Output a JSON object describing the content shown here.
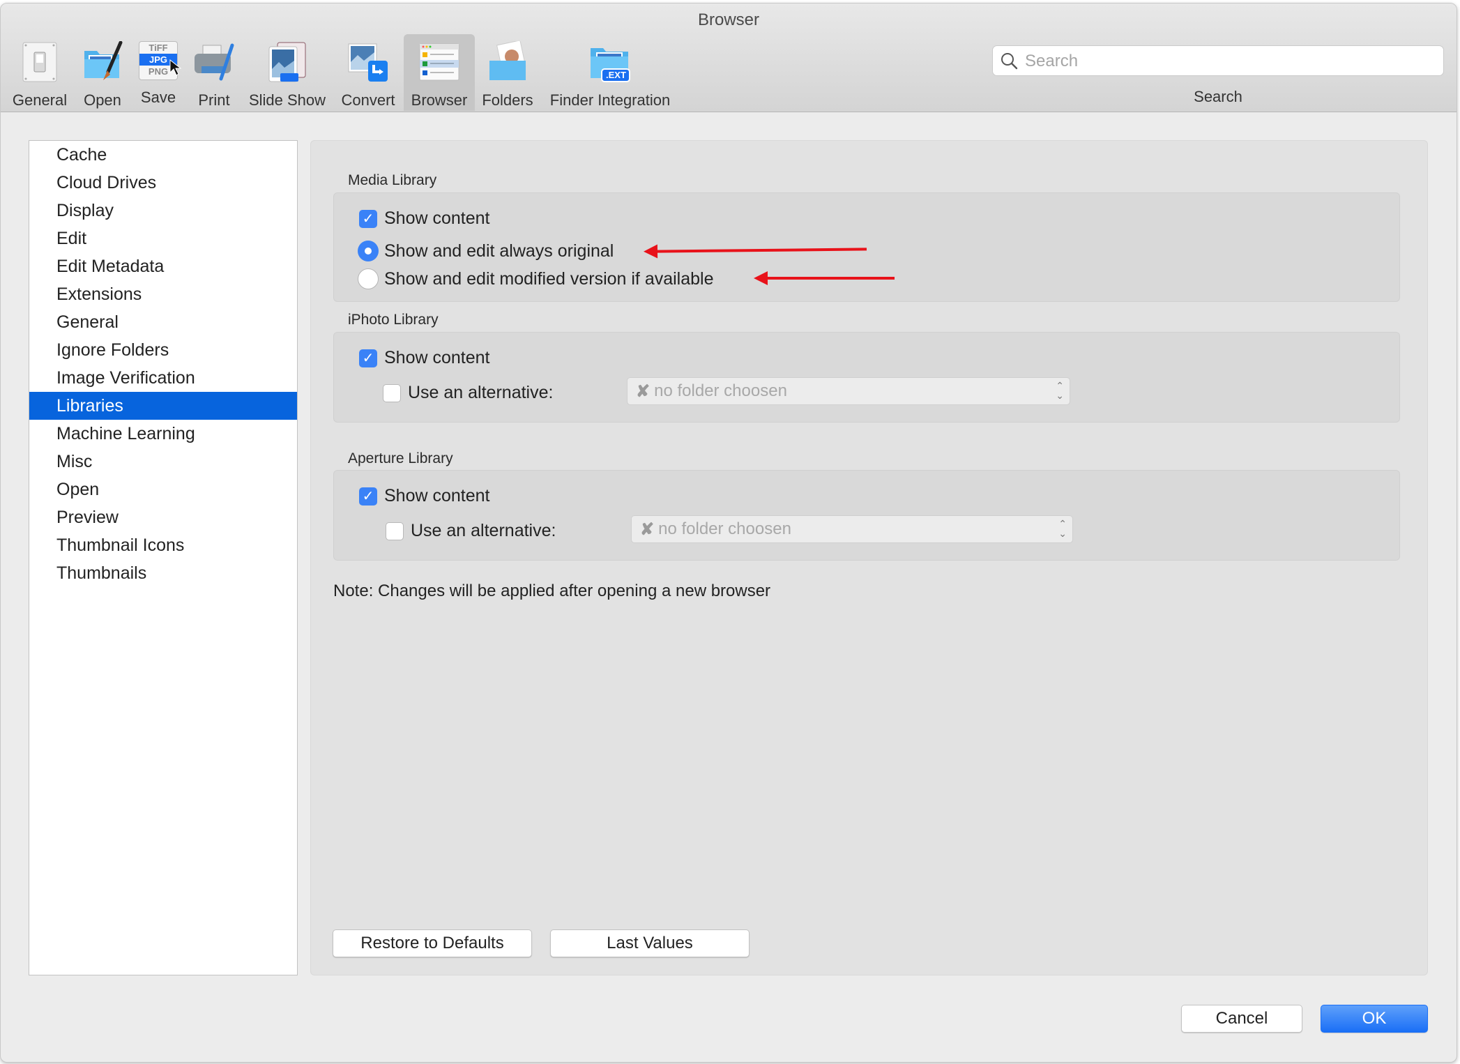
{
  "window": {
    "title": "Browser"
  },
  "toolbar": {
    "items": [
      {
        "label": "General",
        "icon": "light-switch-icon"
      },
      {
        "label": "Open",
        "icon": "folder-brush-icon"
      },
      {
        "label": "Save",
        "icon": "file-formats-icon"
      },
      {
        "label": "Print",
        "icon": "printer-icon"
      },
      {
        "label": "Slide Show",
        "icon": "slideshow-icon"
      },
      {
        "label": "Convert",
        "icon": "convert-icon"
      },
      {
        "label": "Browser",
        "icon": "browser-window-icon",
        "selected": true
      },
      {
        "label": "Folders",
        "icon": "folder-photo-icon"
      },
      {
        "label": "Finder Integration",
        "icon": "folder-ext-icon"
      }
    ],
    "save_icon_text": {
      "tiff": "TiFF",
      "jpg": "JPG",
      "png": "PNG"
    },
    "ext_badge": ".EXT",
    "search": {
      "placeholder": "Search",
      "value": "",
      "label": "Search"
    }
  },
  "sidebar": {
    "items": [
      {
        "label": "Cache"
      },
      {
        "label": "Cloud Drives"
      },
      {
        "label": "Display"
      },
      {
        "label": "Edit"
      },
      {
        "label": "Edit Metadata"
      },
      {
        "label": "Extensions"
      },
      {
        "label": "General"
      },
      {
        "label": "Ignore Folders"
      },
      {
        "label": "Image Verification"
      },
      {
        "label": "Libraries",
        "selected": true
      },
      {
        "label": "Machine Learning"
      },
      {
        "label": "Misc"
      },
      {
        "label": "Open"
      },
      {
        "label": "Preview"
      },
      {
        "label": "Thumbnail Icons"
      },
      {
        "label": "Thumbnails"
      }
    ]
  },
  "main": {
    "media_library": {
      "title": "Media Library",
      "show_content": {
        "label": "Show content",
        "checked": true
      },
      "options": [
        {
          "label": "Show and edit always original",
          "selected": true
        },
        {
          "label": "Show and edit modified version if available",
          "selected": false
        }
      ]
    },
    "iphoto_library": {
      "title": "iPhoto Library",
      "show_content": {
        "label": "Show content",
        "checked": true
      },
      "use_alternative": {
        "label": "Use an alternative:",
        "checked": false
      },
      "folder_popup": {
        "value": "no folder choosen",
        "icon": "x-mark-icon"
      }
    },
    "aperture_library": {
      "title": "Aperture Library",
      "show_content": {
        "label": "Show content",
        "checked": true
      },
      "use_alternative": {
        "label": "Use an alternative:",
        "checked": false
      },
      "folder_popup": {
        "value": "no folder choosen",
        "icon": "x-mark-icon"
      }
    },
    "note": "Note: Changes will be applied after opening a new browser",
    "restore_label": "Restore to Defaults",
    "last_values_label": "Last Values"
  },
  "footer": {
    "cancel_label": "Cancel",
    "ok_label": "OK"
  },
  "glyphs": {
    "check": "✓",
    "x": "✘",
    "up": "⌃",
    "down": "⌄"
  },
  "colors": {
    "accent": "#3a82f7",
    "selection": "#0764dd",
    "annotation_arrow": "#e8121a"
  }
}
